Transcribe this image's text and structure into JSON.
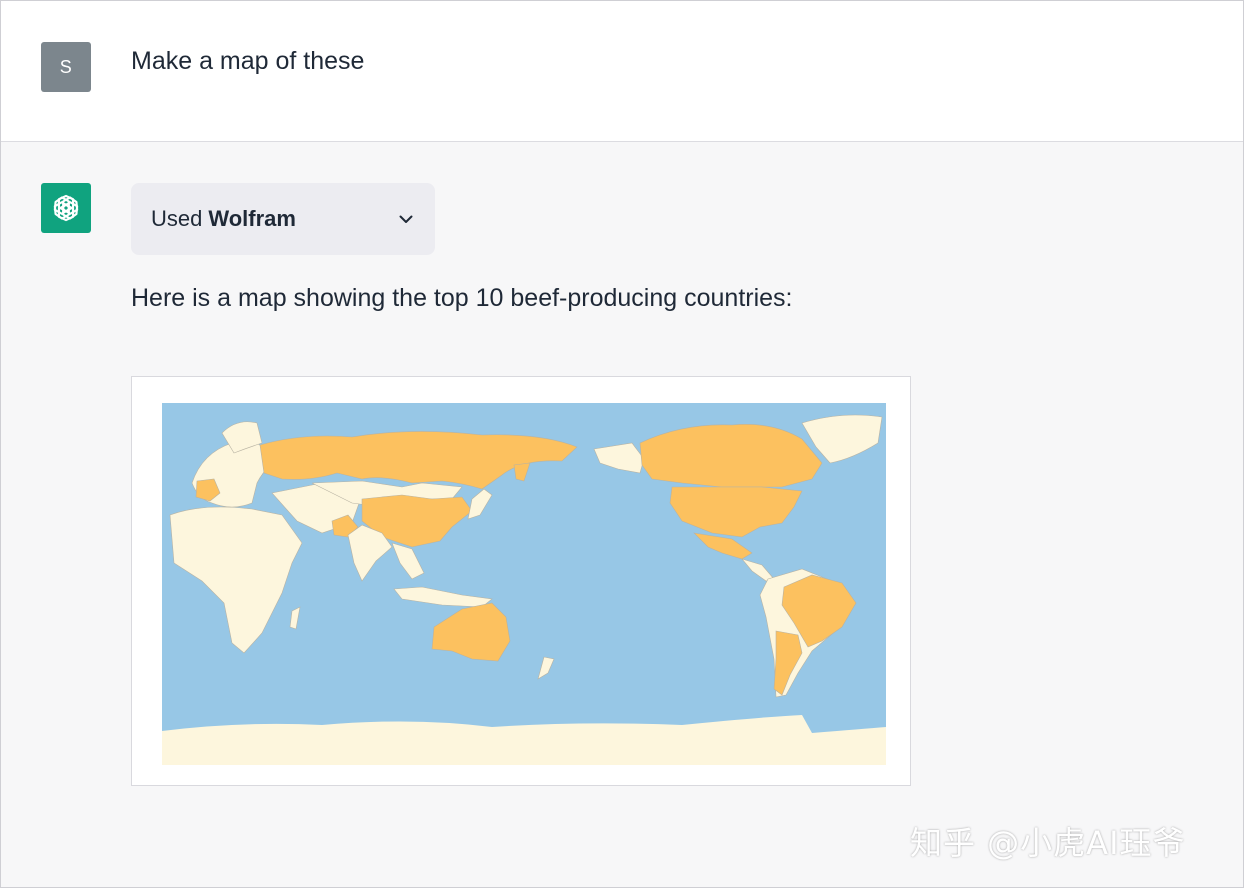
{
  "conversation": {
    "user": {
      "avatar_letter": "S",
      "message": "Make a map of these"
    },
    "assistant": {
      "avatar_icon": "openai-logo-icon",
      "plugin": {
        "prefix": "Used",
        "name": "Wolfram",
        "toggle_icon": "chevron-down-icon"
      },
      "message": "Here is a map showing the top 10 beef-producing countries:",
      "map": {
        "highlighted_countries": [
          "United States",
          "Brazil",
          "China",
          "Argentina",
          "Australia",
          "Russia",
          "Mexico",
          "India",
          "Pakistan",
          "France",
          "Canada"
        ],
        "colors": {
          "ocean": "#97c7e6",
          "land": "#fdf6dd",
          "highlight": "#fcc15f",
          "border": "#b8b3a3"
        }
      }
    }
  },
  "watermark": "知乎 @小虎AI珏爷"
}
